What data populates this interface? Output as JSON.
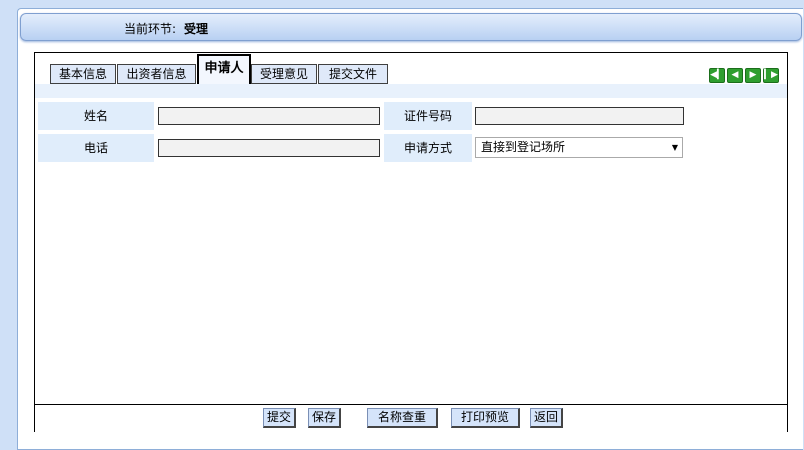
{
  "header": {
    "stage_label": "当前环节:",
    "stage_value": "受理"
  },
  "tabs": [
    {
      "label": "基本信息"
    },
    {
      "label": "出资者信息"
    },
    {
      "label": "申请人"
    },
    {
      "label": "受理意见"
    },
    {
      "label": "提交文件"
    }
  ],
  "active_tab": "申请人",
  "form": {
    "name_label": "姓名",
    "name_value": "",
    "id_label": "证件号码",
    "id_value": "",
    "phone_label": "电话",
    "phone_value": "",
    "method_label": "申请方式",
    "method_value": "直接到登记场所"
  },
  "footer": {
    "submit": "提交",
    "save": "保存",
    "name_check": "名称查重",
    "print_preview": "打印预览",
    "back": "返回"
  },
  "colors": {
    "accent": "#2f9e2f",
    "label_bg": "#e0edfb",
    "page_bg": "#cfe0f7"
  },
  "nav_icons": [
    "first-page-icon",
    "prev-page-icon",
    "next-page-icon",
    "last-page-icon"
  ]
}
